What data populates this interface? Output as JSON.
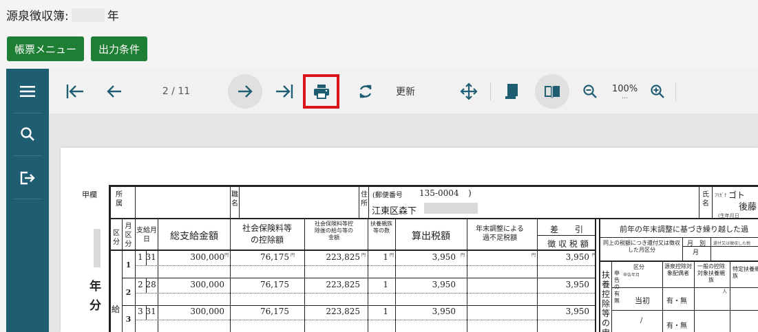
{
  "header": {
    "title_prefix": "源泉徴収簿:",
    "title_suffix": "年"
  },
  "buttons": {
    "menu": "帳票メニュー",
    "output_conditions": "出力条件"
  },
  "toolbar": {
    "page_indicator": "2 / 11",
    "update_label": "更新",
    "zoom_level": "100%",
    "zoom_dots": "..."
  },
  "document": {
    "section_kou": "甲欄",
    "shozoku_1": "所",
    "shozoku_2": "属",
    "shoku_1": "職",
    "shoku_2": "名",
    "jusho_1": "住",
    "jusho_2": "所",
    "postal_label": "(郵便番号",
    "postal_code": "135-0004",
    "postal_close": ")",
    "address": "江東区森下",
    "name_1": "氏",
    "name_2": "名",
    "name_kana": "ﾌﾘｶﾞﾅ",
    "name_kana_value": "ゴト",
    "name_value": "後藤",
    "name_birth_label": "(生年月日",
    "col_kubun": "区分",
    "col_month_kubun": "月区分",
    "col_pay_date": "支給月日",
    "col_total": "総支給金額",
    "col_social": "社会保険料等の控除額",
    "col_after_social": "社会保険料等控除後の給与等の金額",
    "col_dependents": "扶養親族等の数",
    "col_tax": "算出税額",
    "col_adjust": "年末調整による過不足税額",
    "col_deduct_1": "差　　引",
    "col_deduct_2": "徴 収 税 額",
    "prev_year_title": "前年の年末調整に基づき繰り越した過",
    "prev_year_sub": "同上の税額につき還付又は徴収した月区分",
    "prev_month": "月",
    "prev_betsu": "別",
    "prev_small": "還付又は徴収した税",
    "prev_tsuki": "月",
    "fuyou_label": "扶養控除等の申",
    "shinkoku_label": "申告の有無",
    "kubun_label": "区分",
    "shinkoku_year": "申告年月",
    "gensen_label": "源泉控除対象配偶者",
    "ippan_label": "一般の控除対象扶養親族",
    "tokutei_label": "特定扶養親族",
    "person_mark": "人",
    "toushou": "当初",
    "ari_nashi": "有・無",
    "ari_nashi_2": "有・無",
    "slash": "/",
    "side_kyu": "給",
    "side_nen": "年",
    "side_bun": "分",
    "yen_mark": "円",
    "rows": [
      {
        "month": "1",
        "date": "1 31",
        "total": "300,000",
        "social": "76,175",
        "after": "223,825",
        "deps": "1",
        "tax": "3,950",
        "adjust": "",
        "deduct": "3,950"
      },
      {
        "month": "2",
        "date": "2 28",
        "total": "300,000",
        "social": "76,175",
        "after": "223,825",
        "deps": "1",
        "tax": "3,950",
        "adjust": "",
        "deduct": "3,950"
      },
      {
        "month": "3",
        "date": "3 31",
        "total": "300,000",
        "social": "76,175",
        "after": "223,825",
        "deps": "1",
        "tax": "3,950",
        "adjust": "",
        "deduct": "3,950"
      }
    ]
  },
  "colors": {
    "sidebar": "#1f5d73",
    "button_green": "#1e7e34",
    "highlight_red": "#d8141a",
    "toolbar_icon": "#1f5d73"
  },
  "icons": [
    "menu-icon",
    "search-icon",
    "exit-icon",
    "first-page-icon",
    "prev-page-icon",
    "next-page-icon",
    "last-page-icon",
    "print-icon",
    "refresh-icon",
    "move-icon",
    "document-icon",
    "book-icon",
    "zoom-out-icon",
    "zoom-in-icon"
  ]
}
